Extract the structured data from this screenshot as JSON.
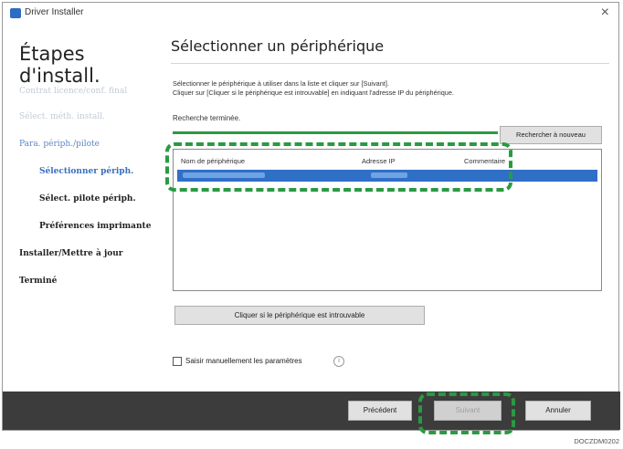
{
  "window": {
    "title": "Driver Installer",
    "close_glyph": "×"
  },
  "sidebar": {
    "title": "Étapes d'install.",
    "steps": [
      {
        "label": "Contrat licence/conf. final",
        "state": "done"
      },
      {
        "label": "Sélect. méth. install.",
        "state": "done"
      },
      {
        "label": "Para. périph./pilote",
        "state": "current"
      },
      {
        "label": "Sélectionner périph.",
        "state": "sub-current"
      },
      {
        "label": "Sélect. pilote périph.",
        "state": "pending"
      },
      {
        "label": "Préférences imprimante",
        "state": "pending"
      },
      {
        "label": "Installer/Mettre à jour",
        "state": "pending"
      },
      {
        "label": "Terminé",
        "state": "pending"
      }
    ]
  },
  "main": {
    "title": "Sélectionner un périphérique",
    "instruction_1": "Sélectionner le périphérique à utiliser dans la liste et cliquer sur [Suivant].",
    "instruction_2": "Cliquer sur [Cliquer si le périphérique est introuvable] en indiquant l'adresse IP du périphérique.",
    "status": "Recherche terminée.",
    "research_button": "Rechercher à nouveau",
    "columns": {
      "name": "Nom de périphérique",
      "ip": "Adresse IP",
      "comment": "Commentaire"
    },
    "not_found_button": "Cliquer si le périphérique est introuvable",
    "manual_checkbox_label": "Saisir manuellement les paramètres",
    "info_glyph": "i"
  },
  "footer": {
    "previous": "Précédent",
    "next": "Suivant",
    "cancel": "Annuler"
  },
  "doc_code": "DOCZDM0202",
  "colors": {
    "highlight_green": "#2a9a42",
    "selection_blue": "#2f6fc6",
    "footer_bg": "#3c3c3c"
  }
}
